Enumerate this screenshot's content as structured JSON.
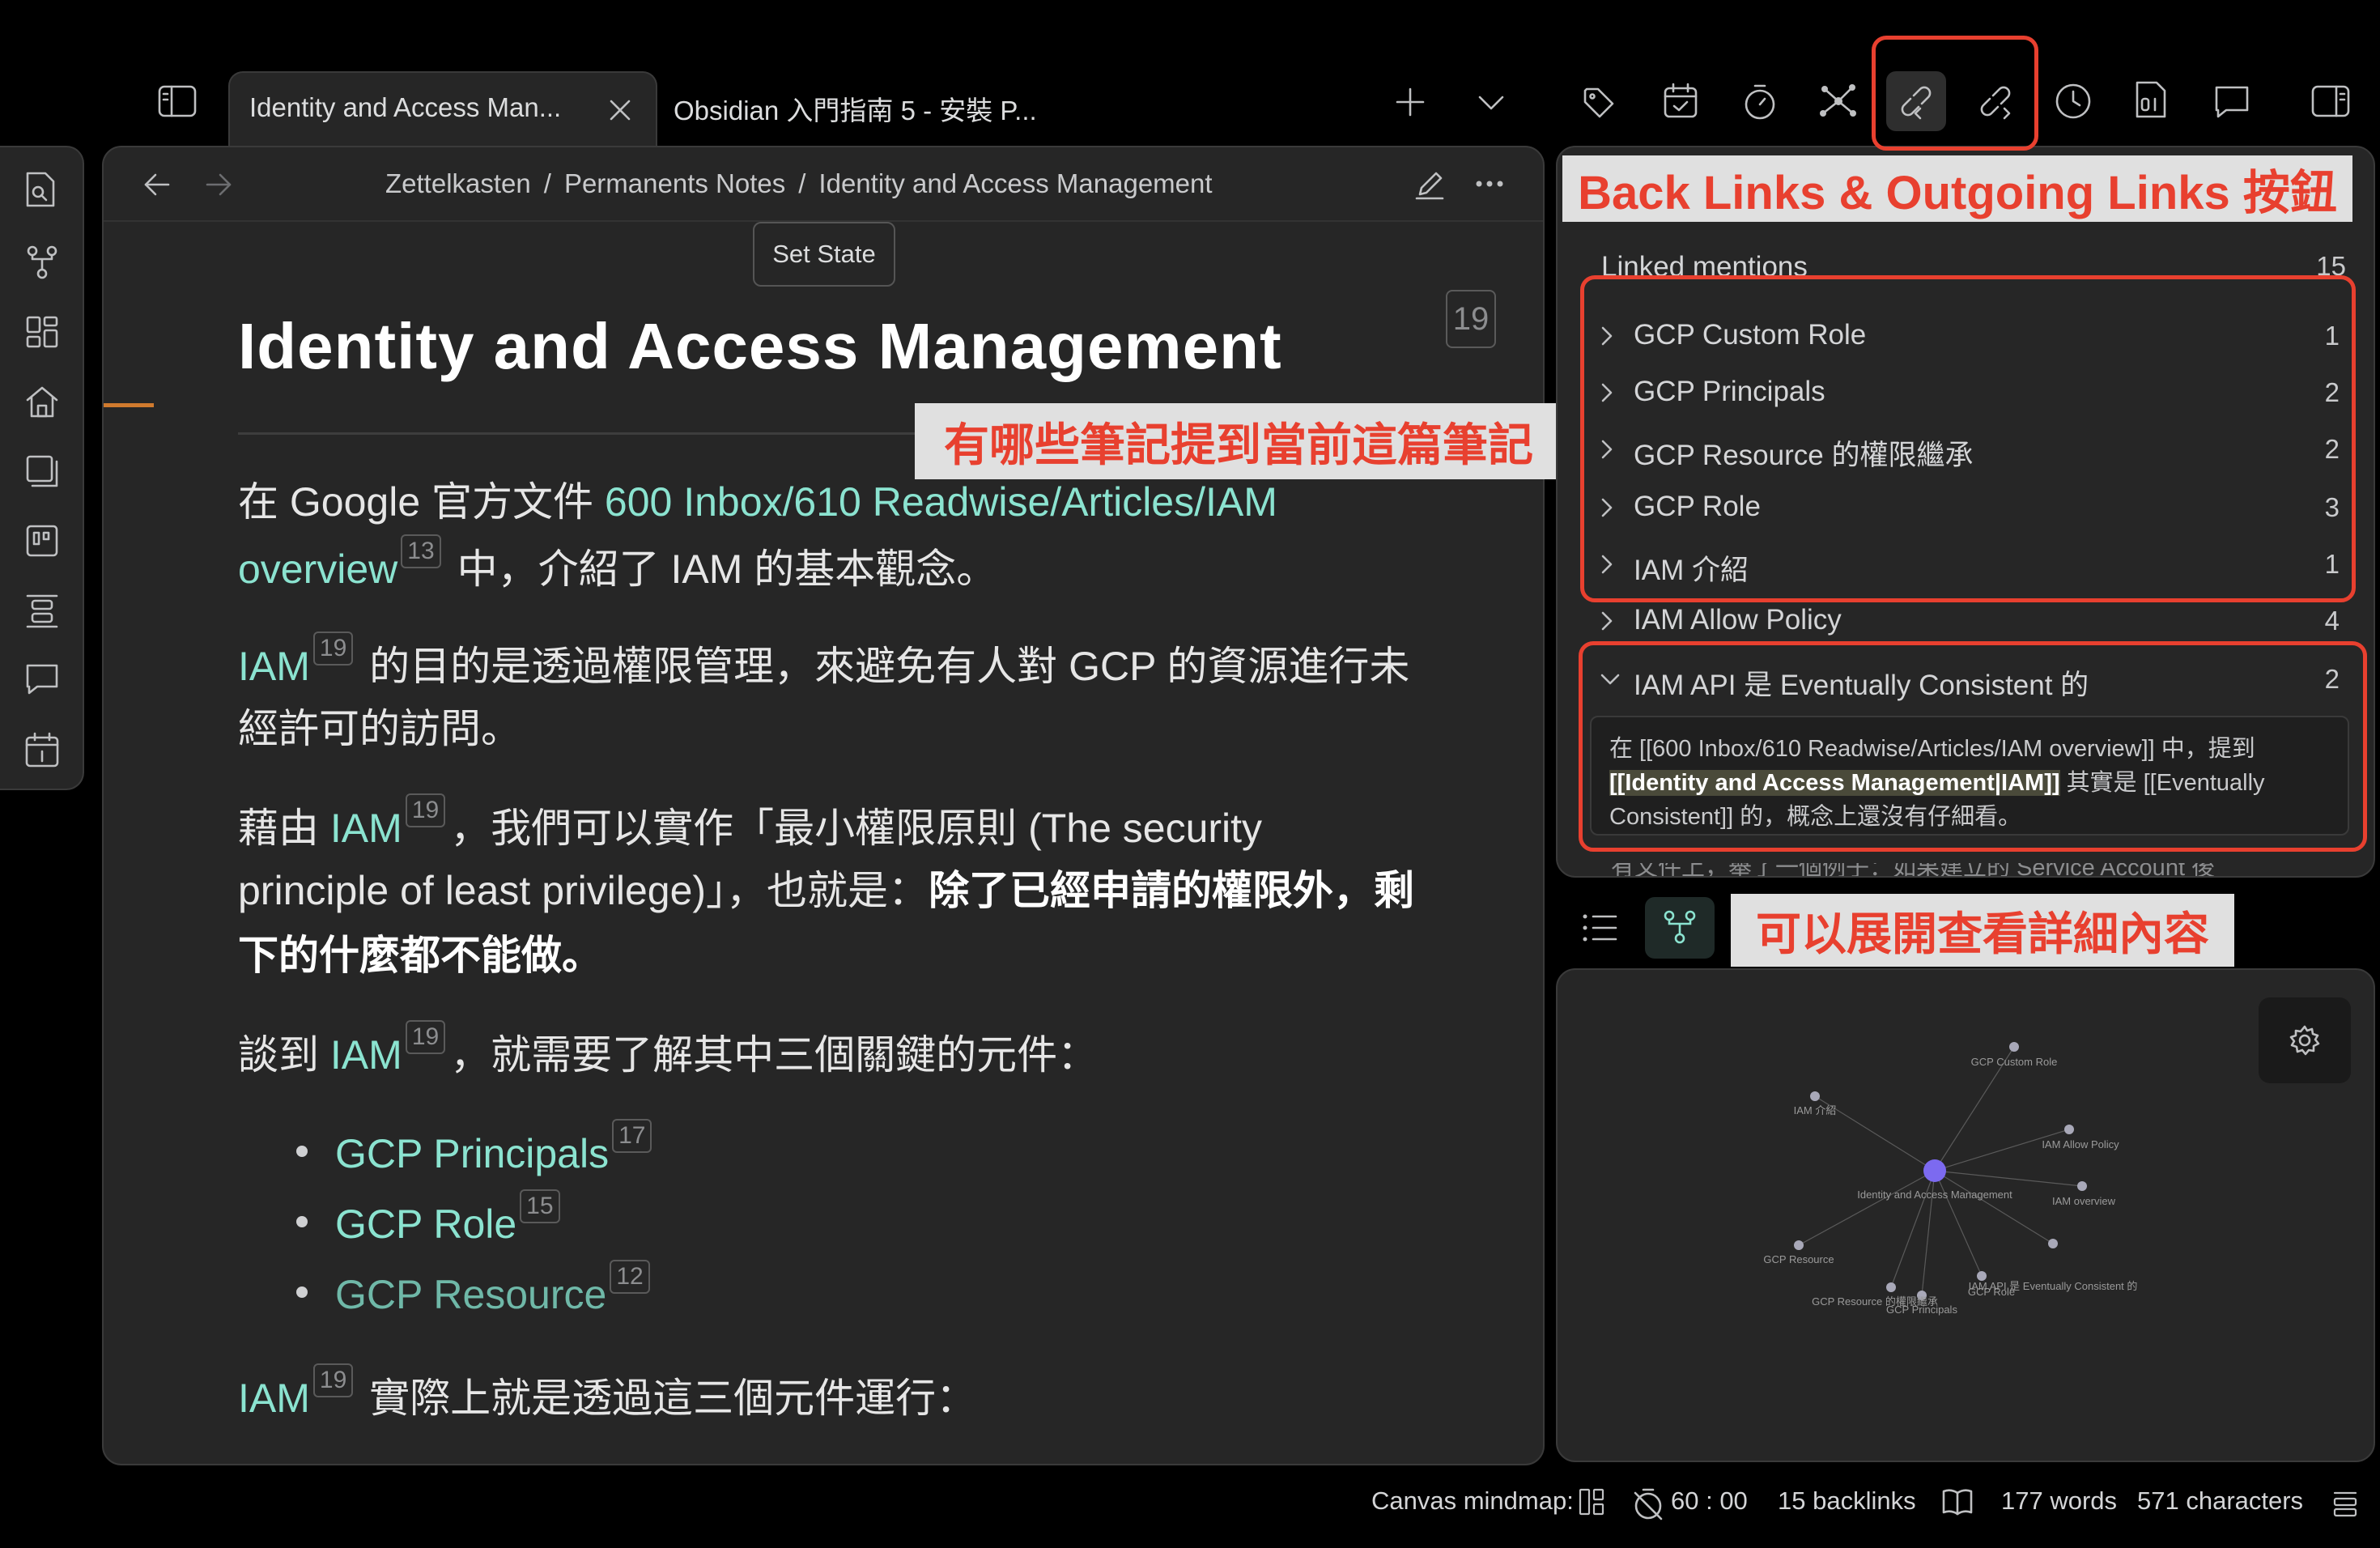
{
  "tabs": [
    {
      "title": "Identity and Access Man...",
      "active": true
    },
    {
      "title": "Obsidian 入門指南 5 - 安裝 P...",
      "active": false
    }
  ],
  "breadcrumb": [
    "Zettelkasten",
    "Permanents Notes",
    "Identity and Access Management"
  ],
  "breadcrumb_sep": "/",
  "editor": {
    "set_state_label": "Set State",
    "title": "Identity and Access Management",
    "title_count": "19",
    "p1_a": "在 Google 官方文件 ",
    "p1_link": "600 Inbox/610 Readwise/Articles/IAM",
    "p1_link2": "overview",
    "p1_sup": "13",
    "p1_b": " 中，介紹了 IAM 的基本觀念。",
    "p2_link": "IAM",
    "p2_sup": "19",
    "p2_a": " 的目的是透過權限管理，來避免有人對 GCP 的資源進行未",
    "p2_b": "經許可的訪問。",
    "p3_a": "藉由 ",
    "p3_link": "IAM",
    "p3_sup": "19",
    "p3_b": "，我們可以實作「最小權限原則 (The security",
    "p3_c": "principle of least privilege)」，也就是：",
    "p3_bold": "除了已經申請的權限外，剩",
    "p3_bold2": "下的什麼都不能做。",
    "p4_a": "談到 ",
    "p4_link": "IAM",
    "p4_sup": "19",
    "p4_b": "，就需要了解其中三個關鍵的元件：",
    "bullets": [
      {
        "text": "GCP Principals",
        "count": "17"
      },
      {
        "text": "GCP Role",
        "count": "15"
      },
      {
        "text": "GCP Resource",
        "count": "12"
      }
    ],
    "p5_link": "IAM",
    "p5_sup": "19",
    "p5_b": " 實際上就是透過這三個元件運行："
  },
  "backlinks": {
    "header": "Linked mentions",
    "header_count": "15",
    "items": [
      {
        "name": "GCP Custom Role",
        "count": "1"
      },
      {
        "name": "GCP Principals",
        "count": "2"
      },
      {
        "name": "GCP Resource 的權限繼承",
        "count": "2"
      },
      {
        "name": "GCP Role",
        "count": "3"
      },
      {
        "name": "IAM 介紹",
        "count": "1"
      },
      {
        "name": "IAM Allow Policy",
        "count": "4"
      },
      {
        "name": "IAM API 是 Eventually Consistent 的",
        "count": "2"
      }
    ],
    "expanded_text_1": "在 [[600 Inbox/610 Readwise/Articles/IAM overview]] 中，提到",
    "expanded_highlight": "[[Identity and Access Management|IAM]]",
    "expanded_text_2": " 其實是 [[Eventually",
    "expanded_text_3": "Consistent]] 的，概念上還沒有仔細看。",
    "cutoff_text": "有文件上，舉了一個例子：如果建立的 Service Account 後"
  },
  "graph": {
    "center": "Identity and Access Management",
    "nodes": [
      "GCP Custom Role",
      "IAM 介紹",
      "IAM Allow Policy",
      "IAM overview",
      "GCP Resource",
      "IAM API 是 Eventually Consistent 的",
      "GCP Resource 的權限繼承",
      "GCP Role",
      "GCP Principals"
    ]
  },
  "annotations": {
    "toolbar_callout": "Back Links & Outgoing Links 按鈕",
    "linked_callout": "有哪些筆記提到當前這篇筆記",
    "expand_callout": "可以展開查看詳細內容"
  },
  "status_bar": {
    "canvas_label": "Canvas mindmap:",
    "timer": "60 : 00",
    "backlinks": "15 backlinks",
    "words": "177 words",
    "characters": "571 characters"
  },
  "colors": {
    "accent_link": "#8be3d0",
    "annotation_red": "#e8402f",
    "graph_center": "#7c6af0",
    "bg": "#000000",
    "pane": "#262626"
  }
}
